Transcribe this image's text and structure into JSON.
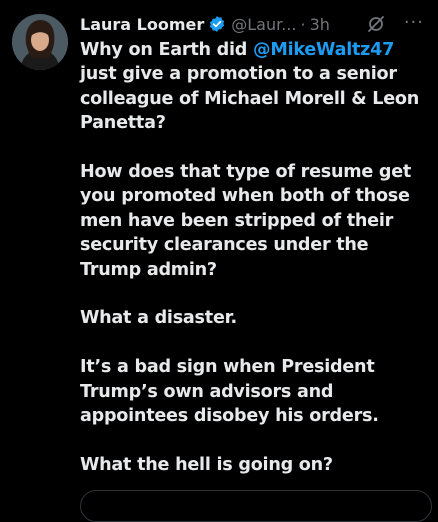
{
  "tweet": {
    "author_name": "Laura Loomer",
    "handle": "@Laur...",
    "separator": "·",
    "time": "3h",
    "more_label": "···",
    "p1_before": "Why on Earth did ",
    "mention": "@MikeWaltz47",
    "p1_after": " just give a promotion to a senior colleague of Michael Morell & Leon Panetta?",
    "p2": "How does that type of resume get you promoted when both of those men have been stripped of their security clearances under the Trump admin?",
    "p3": "What a disaster.",
    "p4": "It’s a bad sign when President Trump’s own advisors and appointees disobey his orders.",
    "p5": "What the hell is going on?"
  },
  "colors": {
    "background": "#000000",
    "text": "#e7e9ea",
    "secondary": "#71767b",
    "accent": "#1d9bf0"
  },
  "icons": {
    "verified": "verified-badge-icon",
    "grok": "grok-icon",
    "more": "more-icon"
  }
}
